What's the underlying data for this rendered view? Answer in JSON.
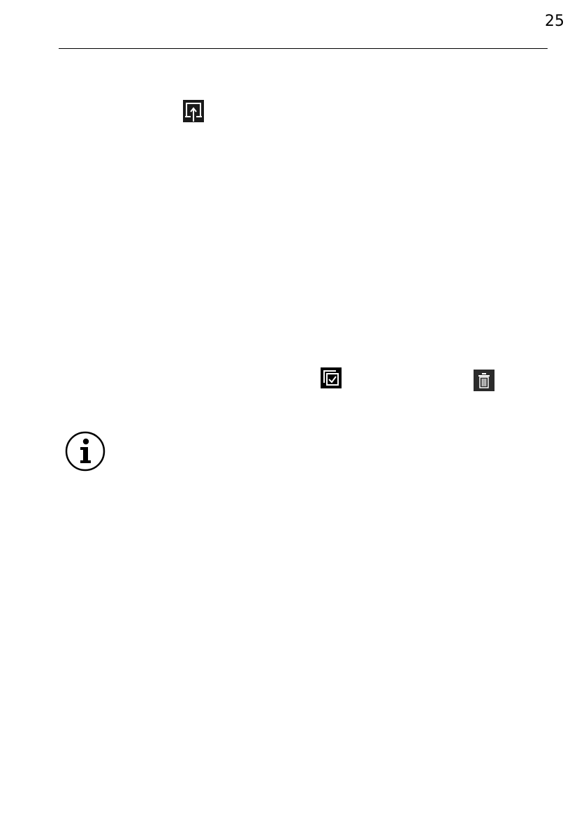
{
  "header": {
    "page_number": "25"
  },
  "icons": {
    "share": "share-export-icon",
    "select": "select-all-icon",
    "delete": "trash-icon",
    "info": "info-icon"
  },
  "colors": {
    "icon_background": "#1a1a1a",
    "text": "#000000",
    "rule": "#000000"
  }
}
